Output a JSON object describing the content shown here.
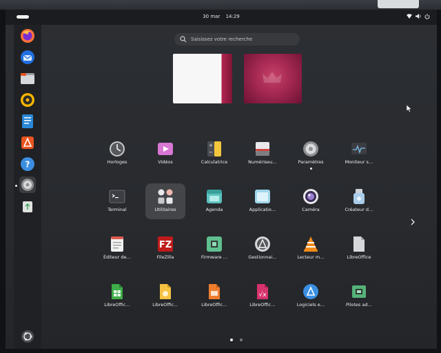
{
  "topbar": {
    "date": "30 mar",
    "time": "14:29",
    "tray_icons": [
      "network-icon",
      "volume-icon",
      "power-icon"
    ]
  },
  "search": {
    "placeholder": "Saisissez votre recherche"
  },
  "dock": {
    "items": [
      {
        "name": "firefox",
        "icon": "firefox-icon"
      },
      {
        "name": "thunderbird",
        "icon": "thunderbird-icon"
      },
      {
        "name": "files",
        "icon": "folder-icon"
      },
      {
        "name": "rhythmbox",
        "icon": "speaker-icon"
      },
      {
        "name": "libreoffice-writer",
        "icon": "document-icon"
      },
      {
        "name": "app-center",
        "icon": "software-icon"
      },
      {
        "name": "help",
        "icon": "help-icon"
      },
      {
        "name": "settings",
        "icon": "gear-icon",
        "active": true
      },
      {
        "name": "trash",
        "icon": "trash-icon"
      }
    ],
    "show_apps_icon": "ubuntu-grid-icon"
  },
  "apps": [
    {
      "label": "Horloges",
      "icon": "clock-icon"
    },
    {
      "label": "Vidéos",
      "icon": "video-icon"
    },
    {
      "label": "Calculatrice",
      "icon": "calculator-icon"
    },
    {
      "label": "Numériseu…",
      "icon": "scanner-icon"
    },
    {
      "label": "Paramètres",
      "icon": "gear-icon",
      "running": true
    },
    {
      "label": "Moniteur s…",
      "icon": "monitor-icon"
    },
    {
      "label": "Terminal",
      "icon": "terminal-icon"
    },
    {
      "label": "Utilitaires",
      "icon": "folder-grid-icon",
      "selected": true
    },
    {
      "label": "Agenda",
      "icon": "calendar-icon"
    },
    {
      "label": "Applicatio…",
      "icon": "window-icon"
    },
    {
      "label": "Caméra",
      "icon": "camera-icon"
    },
    {
      "label": "Créateur d…",
      "icon": "usb-icon"
    },
    {
      "label": "Éditeur de…",
      "icon": "text-editor-icon"
    },
    {
      "label": "FileZilla",
      "icon": "filezilla-icon"
    },
    {
      "label": "Firmware …",
      "icon": "firmware-icon"
    },
    {
      "label": "Gestionnai…",
      "icon": "gestion-icon"
    },
    {
      "label": "Lecteur m…",
      "icon": "vlc-icon"
    },
    {
      "label": "LibreOffice",
      "icon": "libreoffice-icon"
    },
    {
      "label": "LibreOffic…",
      "icon": "calc-icon"
    },
    {
      "label": "LibreOffic…",
      "icon": "draw-icon"
    },
    {
      "label": "LibreOffic…",
      "icon": "impress-icon"
    },
    {
      "label": "LibreOffic…",
      "icon": "math-icon"
    },
    {
      "label": "Logiciels e…",
      "icon": "software-icon"
    },
    {
      "label": "Pilotes ad…",
      "icon": "driver-icon"
    }
  ],
  "pagination": {
    "pages": 2,
    "current": 1
  },
  "colors": {
    "accent": "#e95420",
    "panel": "#1b1c1f",
    "background": "#282a2e"
  }
}
